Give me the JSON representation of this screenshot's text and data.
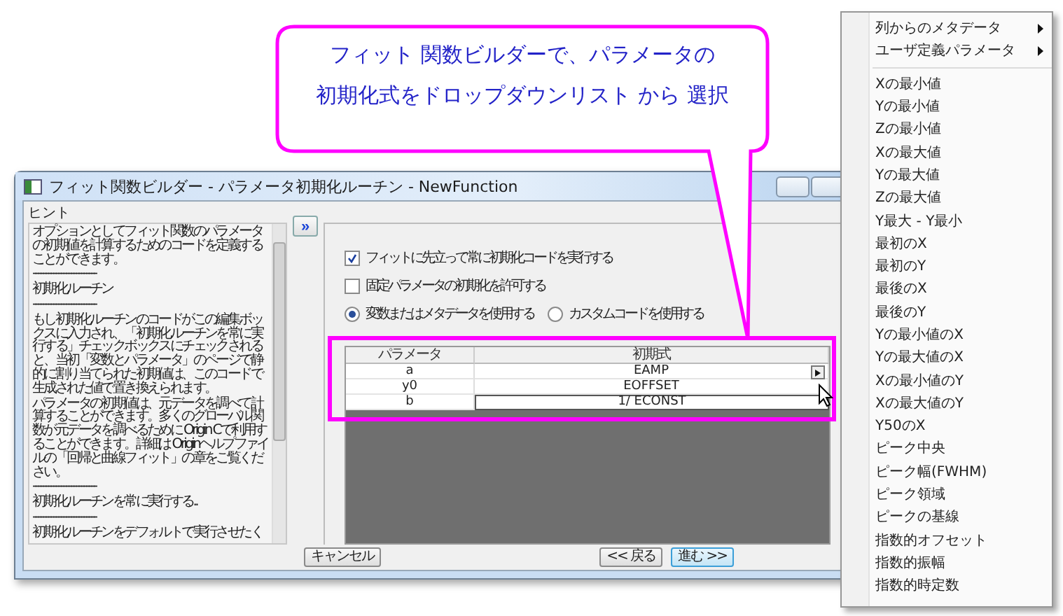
{
  "callout": {
    "lines": [
      "フィット 関数ビルダーで、パラメータの",
      "初期化式をドロップダウンリスト から 選択"
    ]
  },
  "dialog": {
    "title": "フィット関数ビルダー - パラメータ初期化ルーチン - NewFunction",
    "hint": {
      "label": "ヒント",
      "paragraphs": [
        "オプションとしてフィット関数のパラメータの初期値を計算するためのコードを定義することができます。",
        "-------------------------",
        "初期化ルーチン",
        "-------------------------",
        "もし初期化ルーチンのコードがこの編集ボックスに入力され、「初期化ルーチンを常に実行する」チェックボックスにチェックされると、当初「変数とパラメータ」のページで静的に割り当てられた初期値は、このコードで生成された値で置き換えられます。",
        "パラメータの初期値は、元データを調べて計算することができます。多くのグローバル関数が元データを調べるために Origin Cで利用することができます。詳細は Originヘルプファイルの「回帰と曲線フィット」の章をご覧ください。",
        "-------------------------",
        "初期化ルーチンを常に実行する..",
        "-------------------------",
        "初期化ルーチンをデフォルトで実行させたく"
      ]
    },
    "expand_button": "»",
    "options": [
      {
        "label": "フィットに先立って常に初期化コードを実行する",
        "checked": true
      },
      {
        "label": "固定パラメータの初期化を許可する",
        "checked": false
      }
    ],
    "radios": [
      {
        "label": "変数またはメタデータを使用する",
        "selected": true
      },
      {
        "label": "カスタムコードを使用する",
        "selected": false
      }
    ],
    "table": {
      "columns": [
        "パラメータ",
        "初期式"
      ],
      "rows": [
        {
          "parameter": "a",
          "expression": "EAMP",
          "menu_open": true,
          "editing": false
        },
        {
          "parameter": "y0",
          "expression": "EOFFSET",
          "menu_open": false,
          "editing": false
        },
        {
          "parameter": "b",
          "expression": "1/ ECONST",
          "menu_open": false,
          "editing": true
        }
      ]
    },
    "buttons": [
      {
        "label": "キャンセル",
        "default": false
      },
      {
        "label": "<< 戻る",
        "default": false
      },
      {
        "label": "進む >>",
        "default": true
      }
    ]
  },
  "menu": {
    "items": [
      {
        "kind": "submenu",
        "label": "列からのメタデータ"
      },
      {
        "kind": "submenu",
        "label": "ユーザ定義パラメータ"
      },
      {
        "kind": "separator"
      },
      {
        "kind": "item",
        "label": "Xの最小値"
      },
      {
        "kind": "item",
        "label": "Yの最小値"
      },
      {
        "kind": "item",
        "label": "Zの最小値"
      },
      {
        "kind": "item",
        "label": "Xの最大値"
      },
      {
        "kind": "item",
        "label": "Yの最大値"
      },
      {
        "kind": "item",
        "label": "Zの最大値"
      },
      {
        "kind": "item",
        "label": "Y最大 - Y最小"
      },
      {
        "kind": "item",
        "label": "最初のX"
      },
      {
        "kind": "item",
        "label": "最初のY"
      },
      {
        "kind": "item",
        "label": "最後のX"
      },
      {
        "kind": "item",
        "label": "最後のY"
      },
      {
        "kind": "item",
        "label": "Yの最小値のX"
      },
      {
        "kind": "item",
        "label": "Yの最大値のX"
      },
      {
        "kind": "item",
        "label": "Xの最小値のY"
      },
      {
        "kind": "item",
        "label": "Xの最大値のY"
      },
      {
        "kind": "item",
        "label": "Y50のX"
      },
      {
        "kind": "item",
        "label": "ピーク中央"
      },
      {
        "kind": "item",
        "label": "ピーク幅(FWHM)"
      },
      {
        "kind": "item",
        "label": "ピーク領域"
      },
      {
        "kind": "item",
        "label": "ピークの基線"
      },
      {
        "kind": "item",
        "label": "指数的オフセット"
      },
      {
        "kind": "item",
        "label": "指数的振幅"
      },
      {
        "kind": "item",
        "label": "指数的時定数"
      }
    ]
  }
}
